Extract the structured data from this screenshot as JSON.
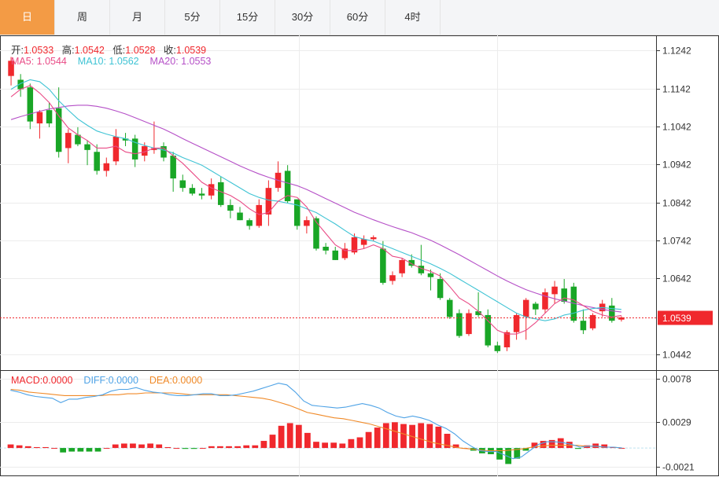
{
  "tabs": [
    {
      "label": "日",
      "active": true
    },
    {
      "label": "周",
      "active": false
    },
    {
      "label": "月",
      "active": false
    },
    {
      "label": "5分",
      "active": false
    },
    {
      "label": "15分",
      "active": false
    },
    {
      "label": "30分",
      "active": false
    },
    {
      "label": "60分",
      "active": false
    },
    {
      "label": "4时",
      "active": false
    }
  ],
  "ohlc": {
    "open_label": "开:",
    "open": "1.0533",
    "high_label": "高:",
    "high": "1.0542",
    "low_label": "低:",
    "low": "1.0528",
    "close_label": "收:",
    "close": "1.0539"
  },
  "ma": {
    "ma5_label": "MA5: ",
    "ma5": "1.0544",
    "ma10_label": "MA10: ",
    "ma10": "1.0562",
    "ma20_label": "MA20: ",
    "ma20": "1.0553"
  },
  "macd_info": {
    "macd_label": "MACD:",
    "macd": "0.0000",
    "diff_label": "DIFF:",
    "diff": "0.0000",
    "dea_label": "DEA:",
    "dea": "0.0000"
  },
  "colors": {
    "up": "#f0282d",
    "down": "#19a626",
    "ma5": "#e94b86",
    "ma10": "#3ec3d4",
    "ma20": "#b54fc7",
    "diff": "#4fa3e6",
    "dea": "#f08a28",
    "accent": "#f39b45"
  },
  "chart_data": [
    {
      "type": "candlestick",
      "ylim": [
        1.0402,
        1.1282
      ],
      "y_ticks": [
        "1.1242",
        "1.1142",
        "1.1042",
        "1.0942",
        "1.0842",
        "1.0742",
        "1.0642",
        "1.0442"
      ],
      "last_price": "1.0539",
      "last_price_value": 1.0539,
      "candles": [
        [
          1.1175,
          1.1225,
          1.115,
          1.1215
        ],
        [
          1.1165,
          1.118,
          1.112,
          1.114
        ],
        [
          1.1145,
          1.1155,
          1.1035,
          1.1055
        ],
        [
          1.105,
          1.1085,
          1.101,
          1.108
        ],
        [
          1.1085,
          1.1105,
          1.104,
          1.105
        ],
        [
          1.109,
          1.1145,
          1.096,
          1.0975
        ],
        [
          1.0985,
          1.1035,
          1.0945,
          1.1025
        ],
        [
          1.102,
          1.104,
          1.099,
          1.0995
        ],
        [
          1.0995,
          1.1005,
          1.094,
          1.098
        ],
        [
          1.0975,
          1.0995,
          1.0915,
          1.0925
        ],
        [
          1.0925,
          1.096,
          1.091,
          1.0945
        ],
        [
          1.095,
          1.1035,
          1.094,
          1.1015
        ],
        [
          1.101,
          1.1025,
          1.099,
          1.1005
        ],
        [
          1.101,
          1.102,
          1.0935,
          1.0955
        ],
        [
          1.0965,
          1.1,
          1.095,
          1.099
        ],
        [
          1.098,
          1.1055,
          1.097,
          1.0985
        ],
        [
          1.099,
          1.1,
          1.095,
          1.096
        ],
        [
          1.0965,
          1.0975,
          1.087,
          1.0905
        ],
        [
          1.09,
          1.0915,
          1.087,
          1.088
        ],
        [
          1.088,
          1.089,
          1.086,
          1.0865
        ],
        [
          1.0865,
          1.088,
          1.085,
          1.086
        ],
        [
          1.086,
          1.0905,
          1.085,
          1.089
        ],
        [
          1.0895,
          1.091,
          1.083,
          1.0835
        ],
        [
          1.0835,
          1.085,
          1.08,
          1.082
        ],
        [
          1.0815,
          1.083,
          1.0795,
          1.0795
        ],
        [
          1.0795,
          1.08,
          1.077,
          1.078
        ],
        [
          1.078,
          1.085,
          1.0775,
          1.0835
        ],
        [
          1.081,
          1.09,
          1.078,
          1.088
        ],
        [
          1.088,
          1.095,
          1.087,
          1.092
        ],
        [
          1.0925,
          1.094,
          1.084,
          1.0845
        ],
        [
          1.085,
          1.085,
          1.077,
          1.078
        ],
        [
          1.078,
          1.0805,
          1.076,
          1.0795
        ],
        [
          1.08,
          1.0805,
          1.0715,
          1.072
        ],
        [
          1.0725,
          1.0735,
          1.0705,
          1.0715
        ],
        [
          1.0715,
          1.0725,
          1.069,
          1.069
        ],
        [
          1.0695,
          1.0735,
          1.069,
          1.072
        ],
        [
          1.071,
          1.076,
          1.0705,
          1.075
        ],
        [
          1.073,
          1.0755,
          1.072,
          1.0745
        ],
        [
          1.0745,
          1.0755,
          1.074,
          1.075
        ],
        [
          1.072,
          1.074,
          1.0625,
          1.063
        ],
        [
          1.0635,
          1.066,
          1.0625,
          1.065
        ],
        [
          1.0655,
          1.0695,
          1.0645,
          1.069
        ],
        [
          1.069,
          1.0705,
          1.067,
          1.0675
        ],
        [
          1.0675,
          1.073,
          1.065,
          1.0655
        ],
        [
          1.0655,
          1.0665,
          1.061,
          1.0645
        ],
        [
          1.064,
          1.0655,
          1.0585,
          1.059
        ],
        [
          1.0585,
          1.059,
          1.0535,
          1.054
        ],
        [
          1.055,
          1.056,
          1.0485,
          1.049
        ],
        [
          1.0495,
          1.056,
          1.049,
          1.055
        ],
        [
          1.0555,
          1.0605,
          1.054,
          1.0545
        ],
        [
          1.0545,
          1.056,
          1.046,
          1.0465
        ],
        [
          1.0465,
          1.0475,
          1.0445,
          1.045
        ],
        [
          1.046,
          1.0505,
          1.045,
          1.05
        ],
        [
          1.05,
          1.055,
          1.048,
          1.0545
        ],
        [
          1.054,
          1.059,
          1.048,
          1.0585
        ],
        [
          1.0575,
          1.058,
          1.0545,
          1.056
        ],
        [
          1.056,
          1.0615,
          1.055,
          1.0605
        ],
        [
          1.06,
          1.0635,
          1.0575,
          1.062
        ],
        [
          1.0615,
          1.064,
          1.0575,
          1.058
        ],
        [
          1.062,
          1.063,
          1.0525,
          1.053
        ],
        [
          1.053,
          1.056,
          1.0495,
          1.0505
        ],
        [
          1.051,
          1.055,
          1.0505,
          1.0545
        ],
        [
          1.0555,
          1.0585,
          1.054,
          1.0575
        ],
        [
          1.057,
          1.059,
          1.0525,
          1.053
        ],
        [
          1.0533,
          1.0542,
          1.0528,
          1.0539
        ]
      ],
      "ma5": [
        1.112,
        1.114,
        1.115,
        1.113,
        1.1105,
        1.107,
        1.1038,
        1.102,
        1.1005,
        1.0985,
        1.0985,
        1.099,
        1.0975,
        1.097,
        1.0975,
        1.0985,
        1.0985,
        1.0965,
        1.0945,
        1.092,
        1.0895,
        1.088,
        1.087,
        1.086,
        1.0845,
        1.0825,
        1.081,
        1.0815,
        1.0845,
        1.086,
        1.0855,
        1.083,
        1.079,
        1.076,
        1.073,
        1.0715,
        1.0715,
        1.072,
        1.073,
        1.072,
        1.07,
        1.0695,
        1.068,
        1.0668,
        1.066,
        1.0648,
        1.062,
        1.059,
        1.0575,
        1.0555,
        1.053,
        1.0505,
        1.0495,
        1.0495,
        1.0505,
        1.0525,
        1.055,
        1.0575,
        1.059,
        1.0585,
        1.057,
        1.0555,
        1.0545,
        1.054,
        1.0544
      ],
      "ma10": [
        1.114,
        1.1155,
        1.1165,
        1.116,
        1.114,
        1.111,
        1.1085,
        1.1062,
        1.1045,
        1.103,
        1.1022,
        1.1015,
        1.101,
        1.1,
        1.0992,
        1.0985,
        1.098,
        1.0972,
        1.096,
        1.095,
        1.094,
        1.0925,
        1.091,
        1.0895,
        1.088,
        1.0865,
        1.0855,
        1.0848,
        1.0845,
        1.084,
        1.0835,
        1.0825,
        1.0815,
        1.08,
        1.0785,
        1.0768,
        1.0752,
        1.0745,
        1.074,
        1.073,
        1.072,
        1.071,
        1.07,
        1.069,
        1.068,
        1.0668,
        1.0655,
        1.064,
        1.0625,
        1.061,
        1.0595,
        1.058,
        1.0565,
        1.055,
        1.054,
        1.0535,
        1.053,
        1.0535,
        1.0545,
        1.055,
        1.0558,
        1.0562,
        1.0565,
        1.0562,
        1.056
      ],
      "ma20": [
        1.106,
        1.1068,
        1.1075,
        1.1082,
        1.1088,
        1.1092,
        1.1096,
        1.1098,
        1.1098,
        1.1095,
        1.109,
        1.1083,
        1.1075,
        1.1065,
        1.1055,
        1.1045,
        1.1035,
        1.1023,
        1.101,
        1.0998,
        1.0986,
        1.0974,
        1.0962,
        1.095,
        1.0938,
        1.0927,
        1.0917,
        1.0908,
        1.09,
        1.0893,
        1.0886,
        1.0876,
        1.0864,
        1.0852,
        1.084,
        1.0828,
        1.0816,
        1.0806,
        1.0796,
        1.0787,
        1.0778,
        1.077,
        1.0762,
        1.0752,
        1.0742,
        1.073,
        1.0717,
        1.0704,
        1.069,
        1.0676,
        1.0662,
        1.0648,
        1.0635,
        1.0623,
        1.0612,
        1.0603,
        1.0595,
        1.0588,
        1.0582,
        1.0576,
        1.057,
        1.0565,
        1.056,
        1.0556,
        1.0553
      ]
    },
    {
      "type": "bar",
      "ylim": [
        -0.003,
        0.0085
      ],
      "y_ticks": [
        "0.0078",
        "0.0029",
        "-0.0021"
      ],
      "hist": [
        0.0004,
        0.0003,
        0.0002,
        0.0001,
        0.0001,
        0.0,
        -0.0005,
        -0.0004,
        -0.0004,
        -0.0004,
        -0.0004,
        0.0,
        0.0004,
        0.0005,
        0.0005,
        0.0004,
        0.0005,
        0.0004,
        0.0001,
        0.0,
        -0.0001,
        -0.0001,
        0.0,
        0.0002,
        0.0002,
        0.0002,
        0.0002,
        0.0003,
        0.0003,
        0.0008,
        0.0015,
        0.0025,
        0.0028,
        0.0026,
        0.0017,
        0.0007,
        0.0006,
        0.0006,
        0.0005,
        0.001,
        0.0012,
        0.0018,
        0.0023,
        0.0028,
        0.0029,
        0.0027,
        0.0026,
        0.0028,
        0.0027,
        0.0024,
        0.0016,
        0.0004,
        0.0,
        -0.0003,
        -0.0006,
        -0.0007,
        -0.0013,
        -0.0018,
        -0.0012,
        -0.0003,
        0.0006,
        0.0008,
        0.0009,
        0.0011,
        0.0007,
        -0.0001,
        0.0003,
        0.0005,
        0.0004,
        0.0001,
        0.0
      ],
      "diff": [
        0.0065,
        0.0063,
        0.006,
        0.0058,
        0.0057,
        0.0056,
        0.0051,
        0.0055,
        0.0055,
        0.0057,
        0.0058,
        0.006,
        0.0064,
        0.0066,
        0.0066,
        0.0068,
        0.0065,
        0.0063,
        0.0062,
        0.006,
        0.0059,
        0.0059,
        0.006,
        0.0061,
        0.0061,
        0.0059,
        0.0059,
        0.006,
        0.0062,
        0.0064,
        0.0067,
        0.007,
        0.0073,
        0.0071,
        0.0063,
        0.0053,
        0.0048,
        0.0047,
        0.0046,
        0.0045,
        0.0046,
        0.0048,
        0.005,
        0.0048,
        0.0045,
        0.004,
        0.0036,
        0.0034,
        0.0036,
        0.0034,
        0.0031,
        0.0026,
        0.0022,
        0.0016,
        0.0008,
        0.0002,
        -0.0003,
        -0.0004,
        -0.0004,
        -0.0008,
        -0.0012,
        -0.001,
        -0.0003,
        0.0004,
        0.0007,
        0.0007,
        0.0006,
        0.0004,
        0.0001,
        0.0002,
        0.0002,
        0.0001,
        0.0001,
        0.0
      ],
      "dea": [
        0.0066,
        0.0065,
        0.0063,
        0.0062,
        0.0061,
        0.006,
        0.0059,
        0.0059,
        0.0059,
        0.0059,
        0.0059,
        0.006,
        0.006,
        0.0061,
        0.0061,
        0.0062,
        0.0062,
        0.0062,
        0.0062,
        0.0061,
        0.006,
        0.006,
        0.006,
        0.006,
        0.006,
        0.0059,
        0.0058,
        0.0057,
        0.0056,
        0.0054,
        0.0051,
        0.0048,
        0.0044,
        0.004,
        0.0038,
        0.0036,
        0.0034,
        0.0033,
        0.0031,
        0.0029,
        0.0027,
        0.0024,
        0.0021,
        0.0018,
        0.0015,
        0.0012,
        0.0009,
        0.0006,
        0.0004,
        0.0002,
        0.0,
        -0.0001,
        -0.0002,
        -0.0003,
        -0.0003,
        -0.0003,
        -0.0002,
        -0.0001,
        0.0001,
        0.0002,
        0.0003,
        0.0003,
        0.0003,
        0.0003,
        0.0002,
        0.0002,
        0.0001,
        0.0001,
        0.0
      ]
    }
  ]
}
